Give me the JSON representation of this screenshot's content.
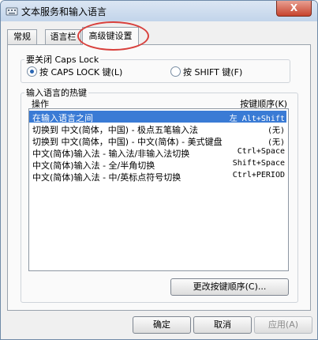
{
  "window": {
    "title": "文本服务和输入语言",
    "close_symbol": "X"
  },
  "tabs": [
    {
      "label": "常规"
    },
    {
      "label": "语言栏"
    },
    {
      "label": "高级键设置"
    }
  ],
  "caps_lock_group": {
    "title": "要关闭 Caps Lock",
    "options": [
      {
        "label": "按 CAPS LOCK 键(L)",
        "checked": true
      },
      {
        "label": "按 SHIFT 键(F)",
        "checked": false
      }
    ]
  },
  "hotkeys_group": {
    "title": "输入语言的热键",
    "columns": {
      "action": "操作",
      "key_sequence": "按键顺序(K)"
    },
    "rows": [
      {
        "action": "在输入语言之间",
        "keys": "左 Alt+Shift"
      },
      {
        "action": "切换到 中文(简体，中国) - 极点五笔输入法",
        "keys": "(无)"
      },
      {
        "action": "切换到 中文(简体，中国) - 中文(简体) - 美式键盘",
        "keys": "(无)"
      },
      {
        "action": "中文(简体)输入法 - 输入法/非输入法切换",
        "keys": "Ctrl+Space"
      },
      {
        "action": "中文(简体)输入法 - 全/半角切换",
        "keys": "Shift+Space"
      },
      {
        "action": "中文(简体)输入法 - 中/英标点符号切换",
        "keys": "Ctrl+PERIOD"
      }
    ],
    "change_button": "更改按键顺序(C)..."
  },
  "buttons": {
    "ok": "确定",
    "cancel": "取消",
    "apply": "应用(A)"
  },
  "colors": {
    "selection": "#3a7bd5",
    "annotation_circle": "#d8403c",
    "title_bar": "#c2d4ea"
  }
}
